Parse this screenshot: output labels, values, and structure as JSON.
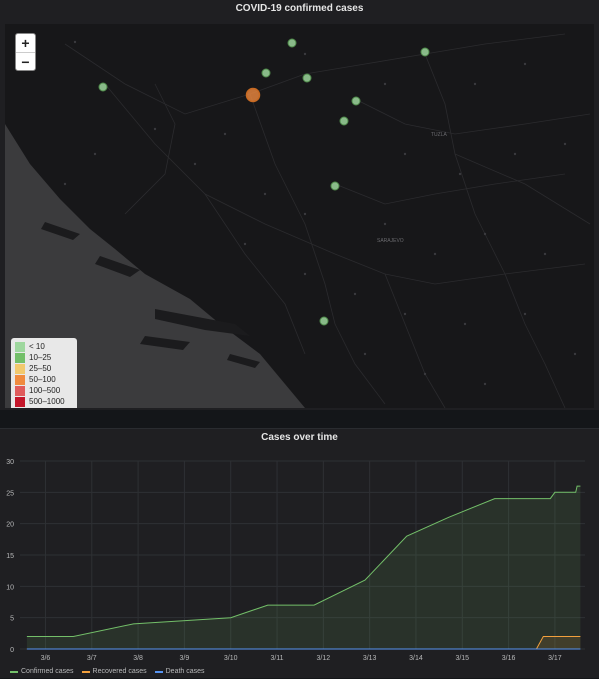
{
  "map_panel": {
    "title": "COVID-19 confirmed cases",
    "zoom_in_label": "+",
    "zoom_out_label": "−",
    "legend": [
      {
        "label": "< 10",
        "color": "#9ed79e"
      },
      {
        "label": "10–25",
        "color": "#73bf69"
      },
      {
        "label": "25–50",
        "color": "#f2c96d"
      },
      {
        "label": "50–100",
        "color": "#f08a3e"
      },
      {
        "label": "100–500",
        "color": "#e05b5b"
      },
      {
        "label": "500–1000",
        "color": "#c4162a"
      }
    ],
    "capital_label": "SARAJEVO",
    "city_label": "TUZLA"
  },
  "chart_panel": {
    "title": "Cases over time",
    "chart_data": {
      "type": "line",
      "x": [
        "3/6",
        "3/7",
        "3/8",
        "3/9",
        "3/10",
        "3/11",
        "3/12",
        "3/13",
        "3/14",
        "3/15",
        "3/16",
        "3/17"
      ],
      "ylim": [
        0,
        30
      ],
      "yticks": [
        0,
        5,
        10,
        15,
        20,
        25,
        30
      ],
      "grid": true,
      "legend_position": "bottom-left",
      "series": [
        {
          "name": "Confirmed cases",
          "color": "#73bf69",
          "points": [
            {
              "x": 5.6,
              "y": 2
            },
            {
              "x": 6.6,
              "y": 2
            },
            {
              "x": 7.9,
              "y": 4
            },
            {
              "x": 10.0,
              "y": 5
            },
            {
              "x": 10.8,
              "y": 7
            },
            {
              "x": 11.8,
              "y": 7
            },
            {
              "x": 12.9,
              "y": 11
            },
            {
              "x": 13.8,
              "y": 18
            },
            {
              "x": 14.7,
              "y": 21
            },
            {
              "x": 15.7,
              "y": 24
            },
            {
              "x": 16.9,
              "y": 24
            },
            {
              "x": 17.0,
              "y": 25
            },
            {
              "x": 17.45,
              "y": 25
            },
            {
              "x": 17.48,
              "y": 26
            },
            {
              "x": 17.55,
              "y": 26
            }
          ]
        },
        {
          "name": "Recovered cases",
          "color": "#f2a03d",
          "points": [
            {
              "x": 5.6,
              "y": 0
            },
            {
              "x": 16.6,
              "y": 0
            },
            {
              "x": 16.75,
              "y": 2
            },
            {
              "x": 17.55,
              "y": 2
            }
          ]
        },
        {
          "name": "Death cases",
          "color": "#5794f2",
          "points": [
            {
              "x": 5.6,
              "y": 0
            },
            {
              "x": 17.55,
              "y": 0
            }
          ]
        }
      ]
    }
  }
}
